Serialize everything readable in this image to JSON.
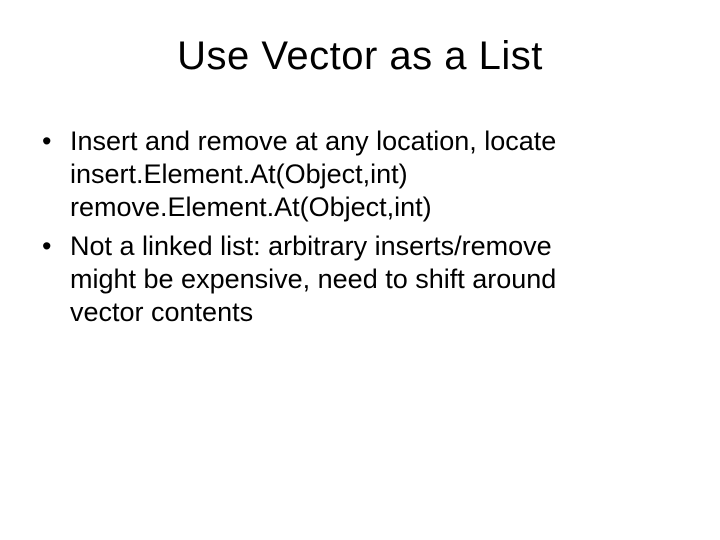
{
  "slide": {
    "title": "Use Vector as a List",
    "bullets": [
      {
        "lines": [
          "Insert and remove at any location, locate",
          "insert.Element.At(Object,int)",
          "remove.Element.At(Object,int)"
        ]
      },
      {
        "lines": [
          "Not a linked list: arbitrary inserts/remove",
          "might be expensive, need to shift around",
          "vector contents"
        ]
      }
    ]
  }
}
